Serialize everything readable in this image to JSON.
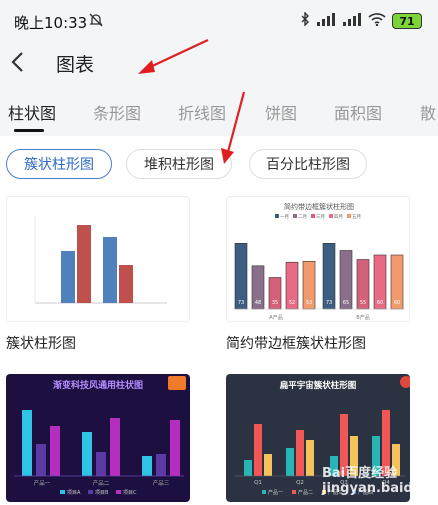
{
  "status": {
    "time": "晚上10:33",
    "battery": "71"
  },
  "header": {
    "title": "图表"
  },
  "tabs": [
    {
      "label": "柱状图",
      "active": true
    },
    {
      "label": "条形图",
      "active": false
    },
    {
      "label": "折线图",
      "active": false
    },
    {
      "label": "饼图",
      "active": false
    },
    {
      "label": "面积图",
      "active": false
    },
    {
      "label": "散",
      "active": false
    }
  ],
  "subtypes": [
    {
      "label": "簇状柱形图",
      "active": true
    },
    {
      "label": "堆积柱形图",
      "active": false
    },
    {
      "label": "百分比柱形图",
      "active": false
    }
  ],
  "templates": [
    {
      "label": "簇状柱形图"
    },
    {
      "label": "简约带边框簇状柱形图"
    },
    {
      "label": ""
    },
    {
      "label": ""
    }
  ],
  "thumb2": {
    "title": "简约带边框簇状柱形图",
    "legend": [
      "一月",
      "二月",
      "三月",
      "四月",
      "五月"
    ],
    "values_a": [
      73,
      48,
      35,
      52,
      53
    ],
    "values_b": [
      73,
      65,
      55,
      60,
      60
    ],
    "cat_a": "A产品",
    "cat_b": "B产品",
    "colors": [
      "#3b5e82",
      "#8a6f8a",
      "#d4607a",
      "#e86b86",
      "#f29a6c"
    ]
  },
  "thumb3": {
    "title": "渐变科技风通用柱状图",
    "categories": [
      "产品一",
      "产品二",
      "产品三"
    ],
    "legend": [
      "项目A",
      "项目B",
      "项目C"
    ]
  },
  "thumb4": {
    "title": "扁平宇宙簇状柱形图",
    "categories": [
      "Q1",
      "Q2",
      "Q3",
      "Q4"
    ],
    "legend": [
      "产品一",
      "产品二",
      "产品三",
      "产品四"
    ]
  },
  "watermark": "Bai百度经验 jingyan.baidu.com"
}
